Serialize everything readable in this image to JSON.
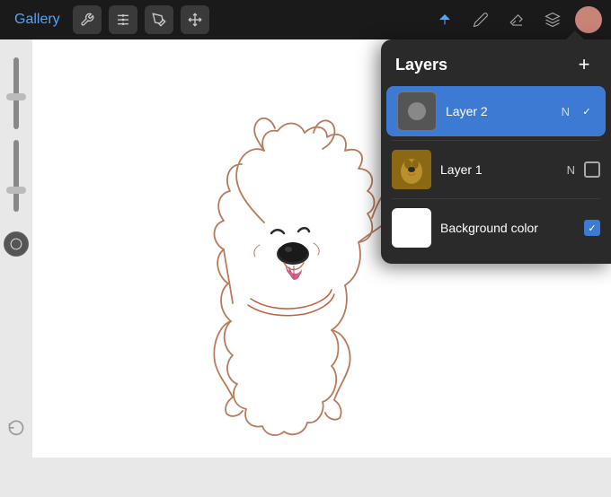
{
  "toolbar": {
    "gallery_label": "Gallery",
    "icon1": "wrench",
    "icon2": "adjustments",
    "icon3": "brush-style",
    "icon4": "transform",
    "right_icon1": "pen",
    "right_icon2": "pencil",
    "right_icon3": "eraser",
    "right_icon4": "layers-stack",
    "avatar_label": "user-avatar"
  },
  "layers_panel": {
    "title": "Layers",
    "add_button": "+",
    "layers": [
      {
        "id": "layer2",
        "name": "Layer 2",
        "blend": "N",
        "active": true,
        "checked": true,
        "has_thumb": false
      },
      {
        "id": "layer1",
        "name": "Layer 1",
        "blend": "N",
        "active": false,
        "checked": false,
        "has_thumb": true
      },
      {
        "id": "bg",
        "name": "Background color",
        "blend": "",
        "active": false,
        "checked": true,
        "is_bg": true
      }
    ]
  },
  "left_sidebar": {
    "undo_label": "↩"
  }
}
